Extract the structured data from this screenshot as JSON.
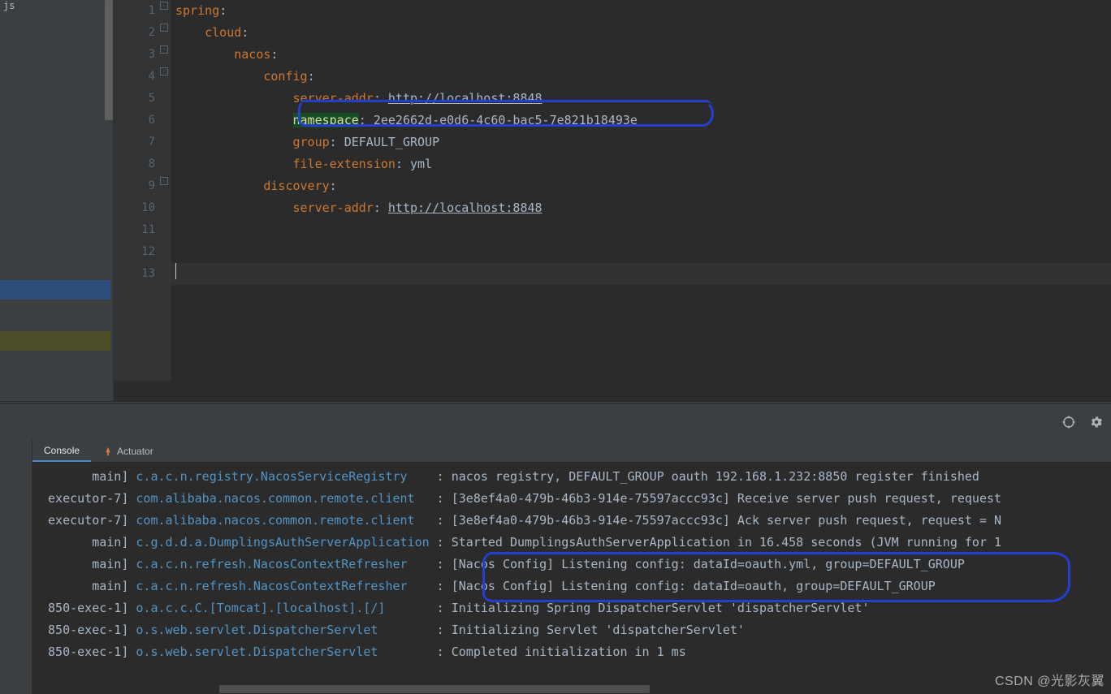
{
  "sidebar": {
    "label_top": "js"
  },
  "editor": {
    "lines": {
      "l1": {
        "key": "spring",
        "punct": ":",
        "indent": ""
      },
      "l2": {
        "key": "cloud",
        "punct": ":",
        "indent": "    "
      },
      "l3": {
        "key": "nacos",
        "punct": ":",
        "indent": "        "
      },
      "l4": {
        "key": "config",
        "punct": ":",
        "indent": "            "
      },
      "l5": {
        "key": "server-addr",
        "punct": ": ",
        "val": "http://localhost:8848",
        "indent": "                "
      },
      "l6": {
        "key": "namespace",
        "punct": ": ",
        "val": "2ee2662d-e0d6-4c60-bac5-7e821b18493e",
        "indent": "                "
      },
      "l7": {
        "key": "group",
        "punct": ": ",
        "val": "DEFAULT_GROUP",
        "indent": "                "
      },
      "l8": {
        "key": "file-extension",
        "punct": ": ",
        "val": "yml",
        "indent": "                "
      },
      "l9": {
        "key": "discovery",
        "punct": ":",
        "indent": "            "
      },
      "l10": {
        "key": "server-addr",
        "punct": ": ",
        "val": "http://localhost:8848",
        "indent": "                "
      }
    },
    "line_numbers": [
      "1",
      "2",
      "3",
      "4",
      "5",
      "6",
      "7",
      "8",
      "9",
      "10",
      "11",
      "12",
      "13"
    ]
  },
  "tabs": {
    "console": "Console",
    "actuator": "Actuator"
  },
  "console": {
    "rows": [
      {
        "thread": "       main] ",
        "logger": "c.a.c.n.registry.NacosServiceRegistry   ",
        "sep": " : ",
        "msg": "nacos registry, DEFAULT_GROUP oauth 192.168.1.232:8850 register finished"
      },
      {
        "thread": " executor-7] ",
        "logger": "com.alibaba.nacos.common.remote.client  ",
        "sep": " : ",
        "msg": "[3e8ef4a0-479b-46b3-914e-75597accc93c] Receive server push request, request"
      },
      {
        "thread": " executor-7] ",
        "logger": "com.alibaba.nacos.common.remote.client  ",
        "sep": " : ",
        "msg": "[3e8ef4a0-479b-46b3-914e-75597accc93c] Ack server push request, request = N"
      },
      {
        "thread": "       main] ",
        "logger": "c.g.d.d.a.DumplingsAuthServerApplication",
        "sep": " : ",
        "msg": "Started DumplingsAuthServerApplication in 16.458 seconds (JVM running for 1"
      },
      {
        "thread": "       main] ",
        "logger": "c.a.c.n.refresh.NacosContextRefresher   ",
        "sep": " : ",
        "msg": "[Nacos Config] Listening config: dataId=oauth.yml, group=DEFAULT_GROUP"
      },
      {
        "thread": "       main] ",
        "logger": "c.a.c.n.refresh.NacosContextRefresher   ",
        "sep": " : ",
        "msg": "[Nacos Config] Listening config: dataId=oauth, group=DEFAULT_GROUP"
      },
      {
        "thread": " 850-exec-1] ",
        "logger": "o.a.c.c.C.[Tomcat].[localhost].[/]      ",
        "sep": " : ",
        "msg": "Initializing Spring DispatcherServlet 'dispatcherServlet'"
      },
      {
        "thread": " 850-exec-1] ",
        "logger": "o.s.web.servlet.DispatcherServlet       ",
        "sep": " : ",
        "msg": "Initializing Servlet 'dispatcherServlet'"
      },
      {
        "thread": " 850-exec-1] ",
        "logger": "o.s.web.servlet.DispatcherServlet       ",
        "sep": " : ",
        "msg": "Completed initialization in 1 ms"
      }
    ]
  },
  "watermark": "CSDN @光影灰翼"
}
